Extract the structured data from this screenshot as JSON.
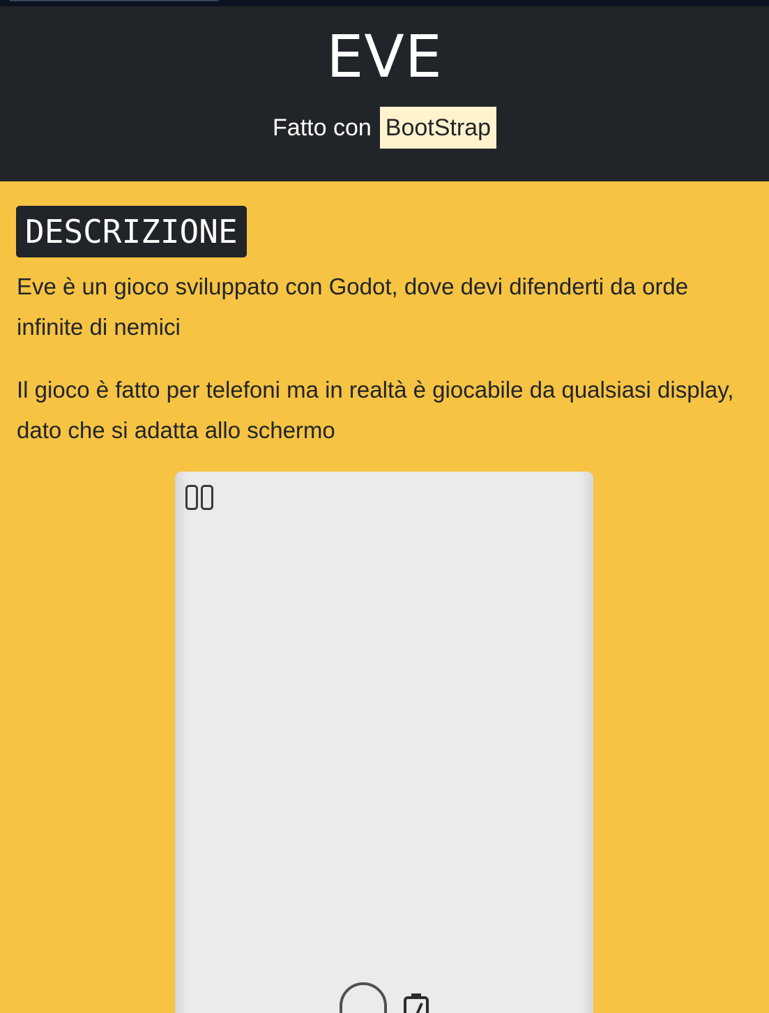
{
  "header": {
    "title": "EVE",
    "made_with_prefix": "Fatto con",
    "made_with_badge": "BootStrap"
  },
  "description": {
    "heading": "DESCRIZIONE",
    "paragraphs": [
      "Eve è un gioco sviluppato con Godot, dove devi difenderti da orde infinite di nemici",
      "Il gioco è fatto per telefoni ma in realtà è giocabile da qualsiasi display, dato che si adatta allo schermo"
    ]
  },
  "game": {
    "icons": [
      "pause-icon",
      "skull-icon",
      "battery-icon"
    ]
  },
  "colors": {
    "header_bg": "#212529",
    "page_bg": "#f6c343",
    "badge_bg": "#fff3cd",
    "game_bg": "#ebebeb",
    "text_dark": "#212529"
  }
}
